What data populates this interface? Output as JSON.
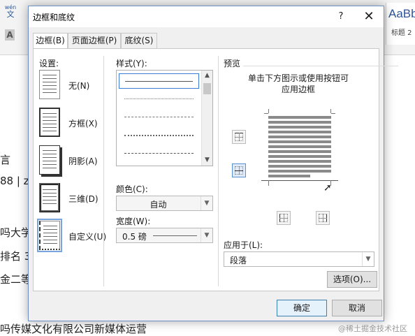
{
  "background_doc": {
    "ribbon_icon_top": "wén",
    "ribbon_icon_bottom": "文",
    "style_sample": "AaBb",
    "style_name": "标题 2",
    "lines": [
      "言",
      "88 | zh",
      "吗大学",
      "排名 3",
      "金二等",
      "吗传媒文化有限公司新媒体运营"
    ]
  },
  "dialog": {
    "title": "边框和底纹",
    "help_label": "?",
    "close_label": "✕",
    "tabs": [
      "边框(B)",
      "页面边框(P)",
      "底纹(S)"
    ],
    "settings": {
      "label": "设置:",
      "items": [
        "无(N)",
        "方框(X)",
        "阴影(A)",
        "三维(D)",
        "自定义(U)"
      ],
      "selected": "自定义(U)"
    },
    "style": {
      "label": "样式(Y):",
      "selected_index": 0,
      "line_styles": [
        "solid",
        "dotted",
        "dashed-small",
        "dashed",
        "dash-dot"
      ]
    },
    "color": {
      "label": "颜色(C):",
      "value": "自动"
    },
    "width": {
      "label": "宽度(W):",
      "value": "0.5 磅"
    },
    "preview": {
      "label": "预览",
      "hint_line1": "单击下方图示或使用按钮可",
      "hint_line2": "应用边框"
    },
    "apply_to": {
      "label": "应用于(L):",
      "value": "段落"
    },
    "options_button": "选项(O)...",
    "ok_button": "确定",
    "cancel_button": "取消"
  },
  "watermark": "@稀土掘金技术社区",
  "icons": {
    "dropdown": "chevron-down-icon",
    "scroll_up": "scroll-up-icon",
    "scroll_down": "scroll-down-icon"
  }
}
